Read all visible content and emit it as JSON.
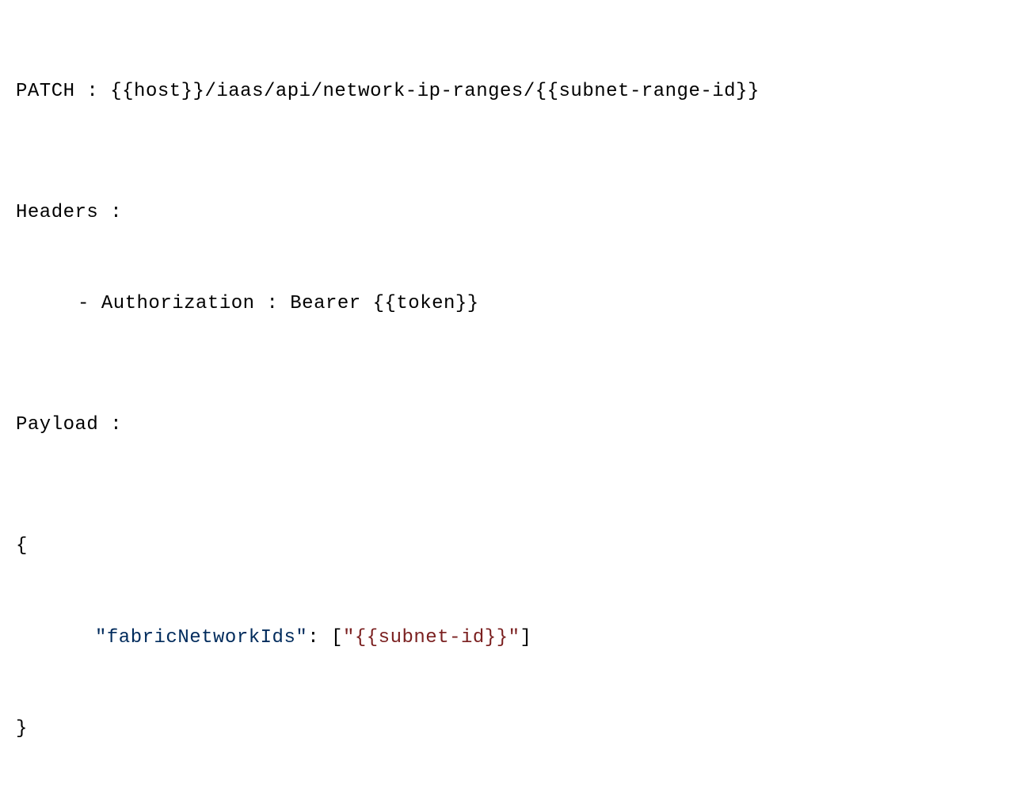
{
  "request": {
    "method": "PATCH",
    "separator": " : ",
    "url": "{{host}}/iaas/api/network-ip-ranges/{{subnet-range-id}}"
  },
  "headers": {
    "label": "Headers :",
    "bullet": "- ",
    "auth_key": "Authorization",
    "auth_sep": " : ",
    "auth_value": "Bearer {{token}}"
  },
  "payload": {
    "label": "Payload :",
    "brace_open": "{",
    "brace_close": "}",
    "key_quoted": "\"fabricNetworkIds\"",
    "colon": ": ",
    "bracket_open": "[",
    "value_quoted": "\"{{subnet-id}}\"",
    "bracket_close": "]"
  }
}
